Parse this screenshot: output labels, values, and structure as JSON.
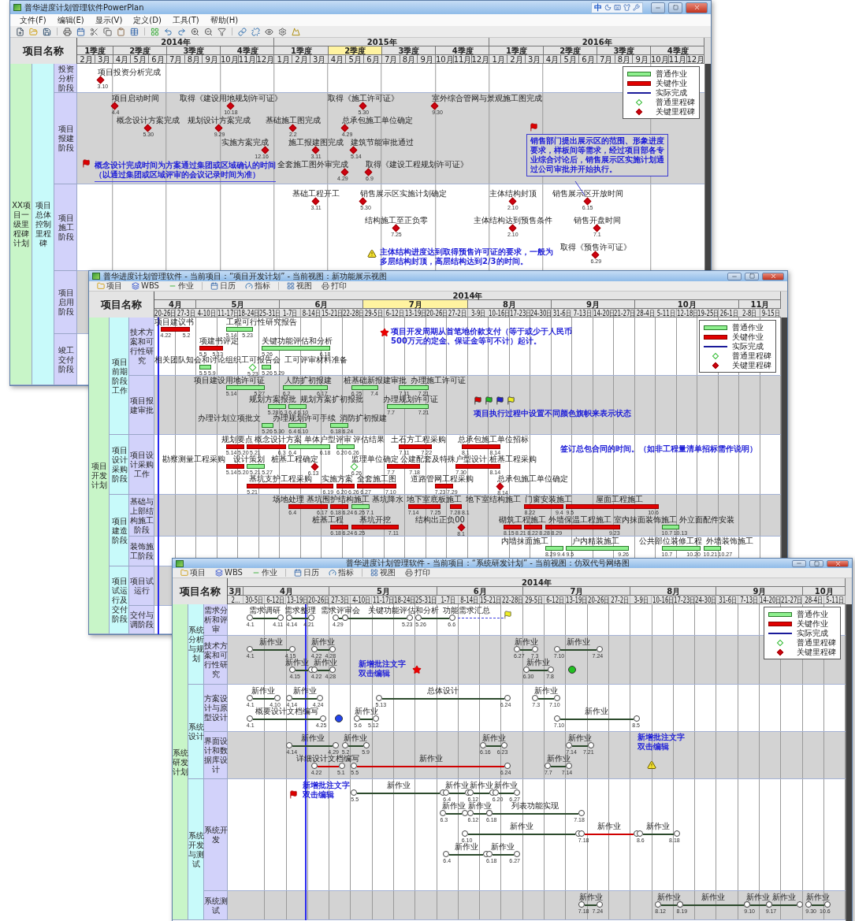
{
  "main_window": {
    "title": "普华进度计划管理软件PowerPlan",
    "ime_mode": "中",
    "menu": [
      "文件(F)",
      "编辑(E)",
      "显示(V)",
      "定义(D)",
      "工具(T)",
      "帮助(H)"
    ],
    "name_header": "项目名称",
    "timeline": {
      "years": [
        "2014年",
        "2015年",
        "2016年"
      ],
      "quarters": [
        {
          "label": "1季度",
          "selected": false
        },
        {
          "label": "2季度",
          "selected": false
        },
        {
          "label": "3季度",
          "selected": false
        },
        {
          "label": "4季度",
          "selected": false
        },
        {
          "label": "1季度",
          "selected": false
        },
        {
          "label": "2季度",
          "selected": true
        },
        {
          "label": "3季度",
          "selected": false
        },
        {
          "label": "4季度",
          "selected": false
        },
        {
          "label": "1季度",
          "selected": false
        },
        {
          "label": "2季度",
          "selected": false
        },
        {
          "label": "3季度",
          "selected": false
        },
        {
          "label": "4季度",
          "selected": false
        }
      ],
      "months": [
        "2月",
        "3月",
        "4月",
        "5月",
        "6月",
        "7月",
        "8月",
        "9月",
        "10月",
        "11月",
        "12月",
        "1月",
        "2月",
        "3月",
        "4月",
        "5月",
        "6月",
        "7月",
        "8月",
        "9月",
        "10月",
        "11月",
        "12月",
        "1月",
        "2月",
        "3月",
        "4月",
        "5月",
        "6月",
        "7月",
        "8月",
        "9月",
        "10月",
        "11月",
        "12月"
      ]
    },
    "legend": [
      {
        "kind": "normal_bar",
        "label": "普通作业"
      },
      {
        "kind": "critical_bar",
        "label": "关键作业"
      },
      {
        "kind": "actual_line",
        "label": "实际完成"
      },
      {
        "kind": "normal_milestone",
        "label": "普通里程碑"
      },
      {
        "kind": "critical_milestone",
        "label": "关键里程碑"
      }
    ],
    "tree": [
      {
        "label": "XX项目一级里程碑计划",
        "children": [
          {
            "label": "项目总体控制里程碑",
            "children": [
              {
                "label": "投资分析阶段",
                "items": [
                  {
                    "kind": "milestone",
                    "label": "项目投资分析完成",
                    "date": "3.10",
                    "critical": true
                  }
                ]
              },
              {
                "label": "项目报建阶段",
                "items": [
                  {
                    "kind": "milestone",
                    "label": "项目启动时间",
                    "date": "4.4",
                    "critical": true
                  },
                  {
                    "kind": "milestone",
                    "label": "取得《建设用地规划许可证》",
                    "date": "10.18",
                    "critical": true
                  },
                  {
                    "kind": "milestone",
                    "label": "取得《施工许可证》",
                    "date": "5.30",
                    "critical": true
                  },
                  {
                    "kind": "milestone",
                    "label": "室外综合管网与景观施工图完成",
                    "date": "9.30",
                    "critical": true
                  },
                  {
                    "kind": "milestone",
                    "label": "概念设计方案完成",
                    "date": "5.30",
                    "critical": true
                  },
                  {
                    "kind": "milestone",
                    "label": "规划设计方案完成",
                    "date": "9.29",
                    "critical": true
                  },
                  {
                    "kind": "milestone",
                    "label": "基础施工图完成",
                    "date": "2.2",
                    "critical": true
                  },
                  {
                    "kind": "milestone",
                    "label": "总承包施工单位确定",
                    "date": "4.29",
                    "critical": true
                  },
                  {
                    "kind": "milestone",
                    "label": "实施方案完成",
                    "date": "12.16",
                    "critical": true
                  },
                  {
                    "kind": "milestone",
                    "label": "施工报建图完成",
                    "date": "3.11",
                    "critical": true
                  },
                  {
                    "kind": "milestone",
                    "label": "建筑节能审批通过",
                    "date": "5.14",
                    "critical": true
                  },
                  {
                    "kind": "note",
                    "lines": [
                      "概念设计完成时间为方案通过集团或区域确认的时间",
                      "（以通过集团或区域评审的会议记录时间为准）"
                    ]
                  },
                  {
                    "kind": "milestone",
                    "label": "全套施工图外审完成",
                    "date": "4.29",
                    "critical": true
                  },
                  {
                    "kind": "milestone",
                    "label": "取得《建设工程规划许可证》",
                    "date": "6.9",
                    "critical": true
                  },
                  {
                    "kind": "note",
                    "lines": [
                      "销售部门提出展示区的范围、形象进度要求，样板间等需求，经过项目部各专业综合讨论后，销售展示区实施计划通过公司审批并开始执行。"
                    ]
                  }
                ]
              },
              {
                "label": "项目施工阶段",
                "items": [
                  {
                    "kind": "milestone",
                    "label": "基础工程开工",
                    "date": "3.11",
                    "critical": true
                  },
                  {
                    "kind": "milestone",
                    "label": "销售展示区实施计划确定",
                    "date": "5.30",
                    "critical": true
                  },
                  {
                    "kind": "milestone",
                    "label": "主体结构封顶",
                    "date": "2.10",
                    "critical": true
                  },
                  {
                    "kind": "milestone",
                    "label": "销售展示区开放时间",
                    "date": "6.15",
                    "critical": true
                  },
                  {
                    "kind": "milestone",
                    "label": "结构施工至正负零",
                    "date": "7.25",
                    "critical": true
                  },
                  {
                    "kind": "milestone",
                    "label": "主体结构达到预售条件",
                    "date": "2.10",
                    "critical": true
                  },
                  {
                    "kind": "milestone",
                    "label": "销售开盘时间",
                    "date": "7.1",
                    "critical": true
                  },
                  {
                    "kind": "note",
                    "lines": [
                      "主体结构进度达到取得预售许可证的要求，一般为",
                      "多层结构封顶，高层结构达到2/3的时间。"
                    ]
                  },
                  {
                    "kind": "milestone",
                    "label": "取得《预售许可证》",
                    "date": "6.29",
                    "critical": true
                  }
                ]
              },
              {
                "label": "项目启用阶段"
              },
              {
                "label": "竣工交付阶段"
              }
            ]
          }
        ]
      }
    ]
  },
  "project_window": {
    "title": "普华进度计划管理软件 - 当前项目：“项目开发计划” - 当前视图：新功能展示视图",
    "toolbar": [
      "项目",
      "WBS",
      "作业",
      "日历",
      "指标",
      "视图",
      "打印"
    ],
    "name_header": "项目名称",
    "timeline": {
      "years": [
        "2014年"
      ],
      "months": [
        {
          "label": "4月",
          "selected": false
        },
        {
          "label": "5月",
          "selected": false
        },
        {
          "label": "6月",
          "selected": false
        },
        {
          "label": "7月",
          "selected": true
        },
        {
          "label": "8月",
          "selected": false
        },
        {
          "label": "9月",
          "selected": false
        },
        {
          "label": "10月",
          "selected": false
        },
        {
          "label": "11月",
          "selected": false
        }
      ],
      "weeks": [
        "20-26日",
        "27-3日",
        "4-10日",
        "11-17日",
        "18-24日",
        "25-31日",
        "1-7日",
        "8-14日",
        "15-21日",
        "22-28日",
        "29-5日",
        "6-12日",
        "13-19日",
        "20-26日",
        "27-2日",
        "3-9日",
        "10-16日",
        "17-23日",
        "24-30日",
        "31-6日",
        "7-13日",
        "14-20日",
        "21-27日",
        "28-4日",
        "5-11日",
        "12-18日",
        "19-25日",
        "26-1日",
        "2-8日",
        "9-15日"
      ]
    },
    "legend": [
      {
        "kind": "normal_bar",
        "label": "普通作业"
      },
      {
        "kind": "critical_bar",
        "label": "关键作业"
      },
      {
        "kind": "actual_line",
        "label": "实际完成"
      },
      {
        "kind": "normal_milestone",
        "label": "普通里程碑"
      },
      {
        "kind": "critical_milestone",
        "label": "关键里程碑"
      }
    ],
    "tree": [
      {
        "label": "项目开发计划",
        "children": [
          {
            "label": "项目前期阶段工作",
            "children": [
              {
                "label": "技术方案和可行性研究",
                "items": [
                  {
                    "kind": "bar",
                    "label": "项目建议书",
                    "start": "4.22",
                    "end": "5.2",
                    "critical": true
                  },
                  {
                    "kind": "bar",
                    "label": "工程可行性研究报告",
                    "start": "5.14",
                    "end": "5.23",
                    "critical": false
                  },
                  {
                    "kind": "note",
                    "lines": [
                      "项目开发周期从首笔地价款支付（等于或少于人民币",
                      "500万元的定金、保证金等可不计）起计。"
                    ]
                  },
                  {
                    "kind": "bar",
                    "label": "项建书评定",
                    "start": "5.5",
                    "end": "5.13",
                    "critical": true
                  },
                  {
                    "kind": "bar",
                    "label": "关键功能评估和分析",
                    "start": "5.26",
                    "end": "6.18",
                    "critical": false
                  },
                  {
                    "kind": "bar",
                    "label": "相关团队知会和讨论",
                    "start": "5.5",
                    "end": "5.9",
                    "critical": false
                  },
                  {
                    "kind": "milestone",
                    "label": "组织工可报告会",
                    "date": "5.23",
                    "critical": false
                  },
                  {
                    "kind": "bar",
                    "label": "工可评审材料准备",
                    "start": "5.26",
                    "end": "5.29",
                    "critical": false
                  }
                ]
              },
              {
                "label": "项目报建审批",
                "items": [
                  {
                    "kind": "bar",
                    "label": "项目建设用地许可证",
                    "start": "5.14",
                    "end": "5.27",
                    "critical": false
                  },
                  {
                    "kind": "bar",
                    "label": "人防扩初报建",
                    "start": "6.2",
                    "end": "6.17",
                    "critical": false
                  },
                  {
                    "kind": "bar",
                    "label": "桩基础新报建审批",
                    "start": "6.25",
                    "end": "7.4",
                    "critical": false
                  },
                  {
                    "kind": "bar",
                    "label": "办理施工许可证",
                    "start": "7.11",
                    "end": "7.21",
                    "critical": false
                  },
                  {
                    "kind": "bar",
                    "label": "规划方案报批",
                    "start": "5.28",
                    "end": "6.3",
                    "critical": false
                  },
                  {
                    "kind": "bar",
                    "label": "规划方案扩初报批",
                    "start": "6.4",
                    "end": "6.10",
                    "critical": false
                  },
                  {
                    "kind": "bar",
                    "label": "办理规划许可证",
                    "start": "7.7",
                    "end": "7.21",
                    "critical": false
                  },
                  {
                    "kind": "note",
                    "lines": [
                      "项目执行过程中设置不同颜色旗帜来表示状态"
                    ]
                  },
                  {
                    "kind": "bar",
                    "label": "办理计划立项批文",
                    "start": "5.26",
                    "end": "5.30",
                    "critical": false
                  },
                  {
                    "kind": "bar",
                    "label": "办理规划许可手续",
                    "start": "6.4",
                    "end": "6.10",
                    "critical": false
                  },
                  {
                    "kind": "bar",
                    "label": "消防扩初报建",
                    "start": "6.18",
                    "end": "6.24",
                    "critical": false
                  }
                ]
              }
            ]
          },
          {
            "label": "项目设计采购阶段",
            "children": [
              {
                "label": "项目设计采购工作",
                "items": [
                  {
                    "kind": "bar",
                    "label": "规划要点",
                    "start": "5.14",
                    "end": "5.20",
                    "critical": true
                  },
                  {
                    "kind": "bar",
                    "label": "概念设计方案",
                    "start": "5.21",
                    "end": "6.3",
                    "critical": true
                  },
                  {
                    "kind": "bar",
                    "label": "单体户型评审",
                    "start": "6.4",
                    "end": "6.18",
                    "critical": false
                  },
                  {
                    "kind": "bar",
                    "label": "评估结果",
                    "start": "6.20",
                    "end": "6.26",
                    "critical": false
                  },
                  {
                    "kind": "bar",
                    "label": "土石方工程采购",
                    "start": "7.11",
                    "end": "7.22",
                    "critical": true
                  },
                  {
                    "kind": "bar",
                    "label": "总承包施工单位招标",
                    "start": "8.1",
                    "end": "8.14",
                    "critical": true
                  },
                  {
                    "kind": "note",
                    "lines": [
                      "签订总包合同的时间。（如非工程量清单招标需作说明）"
                    ]
                  },
                  {
                    "kind": "bar",
                    "label": "勘察测量工程采购",
                    "start": "5.14",
                    "end": "5.20",
                    "critical": true
                  },
                  {
                    "kind": "bar",
                    "label": "设计策划",
                    "start": "5.21",
                    "end": "5.27",
                    "critical": false
                  },
                  {
                    "kind": "milestone",
                    "label": "桩基工程确定",
                    "date": "6.13",
                    "critical": true
                  },
                  {
                    "kind": "milestone",
                    "label": "监理单位确定",
                    "date": "6.26",
                    "critical": false
                  },
                  {
                    "kind": "bar",
                    "label": "公建配套及特殊户型设计",
                    "start": "7.7",
                    "end": "7.18",
                    "critical": true
                  },
                  {
                    "kind": "bar",
                    "label": "桩基工程采购",
                    "start": "7.30",
                    "end": "8.14",
                    "critical": true
                  },
                  {
                    "kind": "bar",
                    "label": "基坑支护工程采购",
                    "start": "5.21",
                    "end": "6.19",
                    "critical": true
                  },
                  {
                    "kind": "bar",
                    "label": "实施方案",
                    "start": "6.20",
                    "end": "6.26",
                    "critical": true
                  },
                  {
                    "kind": "bar",
                    "label": "全套施工图",
                    "start": "6.27",
                    "end": "7.10",
                    "critical": true
                  },
                  {
                    "kind": "bar",
                    "label": "道路管网工程采购",
                    "start": "7.23",
                    "end": "7.29",
                    "critical": true
                  },
                  {
                    "kind": "milestone",
                    "label": "总承包施工单位确定",
                    "date": "8.14",
                    "critical": true
                  }
                ]
              }
            ]
          },
          {
            "label": "项目建造阶段",
            "children": [
              {
                "label": "基础与上部结构施工阶段",
                "items": [
                  {
                    "kind": "bar",
                    "label": "场地处理",
                    "start": "6.4",
                    "end": "6.17",
                    "critical": true
                  },
                  {
                    "kind": "bar",
                    "label": "基坑围护结构施工",
                    "start": "6.18",
                    "end": "6.24",
                    "critical": true
                  },
                  {
                    "kind": "bar",
                    "label": "基坑降水",
                    "start": "6.25",
                    "end": "7.1",
                    "critical": false
                  },
                  {
                    "kind": "bar",
                    "label": "地下室底板施工",
                    "start": "7.14",
                    "end": "7.25",
                    "critical": true
                  },
                  {
                    "kind": "bar",
                    "label": "地下室结构施工",
                    "start": "7.28",
                    "end": "8.1",
                    "critical": true
                  },
                  {
                    "kind": "bar",
                    "label": "门窗安装施工",
                    "start": "8.22",
                    "end": "9.4",
                    "critical": true
                  },
                  {
                    "kind": "bar",
                    "label": "屋面工程施工",
                    "start": "9.5",
                    "end": "10.6",
                    "critical": true
                  },
                  {
                    "kind": "bar",
                    "label": "桩基工程",
                    "start": "6.18",
                    "end": "6.24",
                    "critical": true
                  },
                  {
                    "kind": "bar",
                    "label": "基坑开挖",
                    "start": "6.25",
                    "end": "7.11",
                    "critical": true
                  },
                  {
                    "kind": "milestone",
                    "label": "结构出正负00",
                    "date": "8.1",
                    "critical": true
                  },
                  {
                    "kind": "bar",
                    "label": "砌筑工程施工",
                    "start": "8.15",
                    "end": "8.21",
                    "critical": true
                  },
                  {
                    "kind": "bar",
                    "label": "外墙保温工程施工",
                    "start": "8.22",
                    "end": "8.28",
                    "critical": true
                  },
                  {
                    "kind": "bar",
                    "label": "室内抹面装饰施工",
                    "start": "8.29",
                    "end": "9.23",
                    "critical": true
                  },
                  {
                    "kind": "bar",
                    "label": "外立面配件安装",
                    "start": "10.7",
                    "end": "10.13",
                    "critical": false
                  }
                ]
              },
              {
                "label": "装饰施工阶段",
                "items": [
                  {
                    "kind": "bar",
                    "label": "内墙抹面施工",
                    "start": "8.29",
                    "end": "9.4",
                    "critical": false
                  },
                  {
                    "kind": "bar",
                    "label": "户内精装施工",
                    "start": "9.5",
                    "end": "9.26",
                    "critical": false
                  },
                  {
                    "kind": "bar",
                    "label": "公共部位装修工程",
                    "start": "10.7",
                    "end": "10.20",
                    "critical": false
                  },
                  {
                    "kind": "bar",
                    "label": "外墙装饰施工",
                    "start": "10.21",
                    "end": "10.27",
                    "critical": false
                  }
                ]
              }
            ]
          },
          {
            "label": "项目试运行及交付阶段",
            "children": [
              {
                "label": "项目试运行"
              },
              {
                "label": "交付与调阶段"
              }
            ]
          }
        ]
      }
    ]
  },
  "network_window": {
    "title": "普华进度计划管理软件 - 当前项目：“系统研发计划” - 当前视图：仿双代号网络图",
    "toolbar": [
      "项目",
      "WBS",
      "作业",
      "日历",
      "指标",
      "视图",
      "打印"
    ],
    "name_header": "项目名称",
    "timeline": {
      "years": [
        "2014年"
      ],
      "months": [
        {
          "label": "3月",
          "selected": false
        },
        {
          "label": "4月",
          "selected": false
        },
        {
          "label": "5月",
          "selected": false
        },
        {
          "label": "6月",
          "selected": false
        },
        {
          "label": "7月",
          "selected": false
        },
        {
          "label": "8月",
          "selected": false
        },
        {
          "label": "9月",
          "selected": false
        },
        {
          "label": "10月",
          "selected": false
        }
      ],
      "weeks": [
        "2...",
        "30-5日",
        "6-12日",
        "13-19日",
        "20-26日",
        "27-3日",
        "4-10日",
        "11-17日",
        "18-24日",
        "25-31日",
        "1-7日",
        "8-14日",
        "15-21日",
        "22-28日",
        "29-5日",
        "6-12日",
        "13-19日",
        "20-26日",
        "27-2日",
        "3-9日",
        "10-16日",
        "17-23日",
        "24-30日",
        "31-6日",
        "7-13日",
        "14-20日",
        "21-27日",
        "28-4日",
        "5-11日"
      ]
    },
    "legend": [
      {
        "kind": "normal_bar",
        "label": "普通作业"
      },
      {
        "kind": "critical_bar",
        "label": "关键作业"
      },
      {
        "kind": "actual_line",
        "label": "实际完成"
      },
      {
        "kind": "normal_milestone",
        "label": "普通里程碑"
      },
      {
        "kind": "critical_milestone",
        "label": "关键里程碑"
      }
    ],
    "tree": [
      {
        "label": "系统研发计划",
        "children": [
          {
            "label": "系统分析与规划",
            "children": [
              {
                "label": "需求分析和评审",
                "items": [
                  {
                    "kind": "activity",
                    "label": "需求调研",
                    "start": "4.1",
                    "end": "4.11",
                    "critical": false
                  },
                  {
                    "kind": "activity",
                    "label": "需求整理",
                    "start": "4.14",
                    "end": "4.21",
                    "critical": false
                  },
                  {
                    "kind": "activity",
                    "label": "需求评审会",
                    "start": "4.29",
                    "critical": false
                  },
                  {
                    "kind": "activity",
                    "label": "关键功能评估和分析",
                    "end": "5.23",
                    "critical": false
                  },
                  {
                    "kind": "activity",
                    "label": "功能需求汇总",
                    "start": "5.26",
                    "end": "6.6",
                    "critical": false
                  }
                ]
              },
              {
                "label": "技术方案和可行性研究",
                "items": [
                  {
                    "kind": "activity",
                    "label": "新作业",
                    "start": "4.1",
                    "end": "4.15",
                    "critical": false
                  },
                  {
                    "kind": "activity",
                    "label": "新作业",
                    "start": "4.22",
                    "end": "4.28",
                    "critical": false
                  },
                  {
                    "kind": "activity",
                    "label": "新作业",
                    "start": "6.27",
                    "end": "7.3",
                    "critical": false
                  },
                  {
                    "kind": "activity",
                    "label": "新作业",
                    "start": "7.10",
                    "end": "7.24",
                    "critical": false
                  },
                  {
                    "kind": "activity",
                    "label": "新作业",
                    "start": "4.15",
                    "critical": false
                  },
                  {
                    "kind": "activity",
                    "label": "新作业",
                    "start": "4.22",
                    "end": "4.28",
                    "critical": false
                  },
                  {
                    "kind": "note",
                    "lines": [
                      "新增批注文字",
                      "双击编辑"
                    ]
                  },
                  {
                    "kind": "activity",
                    "label": "新作业",
                    "start": "6.30",
                    "end": "7.8",
                    "critical": false
                  }
                ]
              }
            ]
          },
          {
            "label": "系统设计",
            "children": [
              {
                "label": "方案设计与原型设计",
                "items": [
                  {
                    "kind": "activity",
                    "label": "新作业",
                    "start": "4.1",
                    "end": "4.10",
                    "critical": false
                  },
                  {
                    "kind": "activity",
                    "label": "新作业",
                    "start": "4.14",
                    "end": "4.24",
                    "critical": false
                  },
                  {
                    "kind": "activity",
                    "label": "总体设计",
                    "start": "5.13",
                    "end": "6.24",
                    "critical": false
                  },
                  {
                    "kind": "activity",
                    "label": "新作业",
                    "start": "7.3",
                    "end": "7.10",
                    "critical": false
                  },
                  {
                    "kind": "activity",
                    "label": "概要设计文档编写",
                    "start": "4.1",
                    "end": "4.25",
                    "critical": false
                  },
                  {
                    "kind": "activity",
                    "label": "新作业",
                    "start": "5.6",
                    "end": "5.12",
                    "critical": false
                  },
                  {
                    "kind": "activity",
                    "label": "新作业",
                    "start": "7.10",
                    "end": "8.5",
                    "critical": false
                  }
                ]
              },
              {
                "label": "界面设计和数据库设计",
                "items": [
                  {
                    "kind": "activity",
                    "label": "新作业",
                    "start": "4.14",
                    "end": "4.29",
                    "critical": false
                  },
                  {
                    "kind": "activity",
                    "label": "新作业",
                    "start": "5.2",
                    "end": "5.9",
                    "critical": false
                  },
                  {
                    "kind": "activity",
                    "label": "新作业",
                    "start": "6.16",
                    "end": "6.23",
                    "critical": false
                  },
                  {
                    "kind": "activity",
                    "label": "新作业",
                    "start": "7.14",
                    "end": "7.21",
                    "critical": false
                  },
                  {
                    "kind": "note",
                    "lines": [
                      "新增批注文字",
                      "双击编辑"
                    ]
                  },
                  {
                    "kind": "activity",
                    "label": "详细设计文档编写",
                    "start": "4.22",
                    "end": "5.1",
                    "critical": true
                  },
                  {
                    "kind": "activity",
                    "label": "新作业",
                    "start": "5.5",
                    "end": "6.24",
                    "critical": true
                  },
                  {
                    "kind": "activity",
                    "label": "新作业",
                    "start": "7.7",
                    "end": "7.14",
                    "critical": false
                  }
                ]
              }
            ]
          },
          {
            "label": "系统开发与测试",
            "children": [
              {
                "label": "系统开发",
                "items": [
                  {
                    "kind": "note",
                    "lines": [
                      "新增批注文字",
                      "双击编辑"
                    ]
                  },
                  {
                    "kind": "activity",
                    "label": "新作业",
                    "start": "5.5",
                    "critical": false
                  },
                  {
                    "kind": "activity",
                    "label": "新作业",
                    "start": "6.4",
                    "critical": false
                  },
                  {
                    "kind": "activity",
                    "label": "新作业",
                    "start": "6.12",
                    "critical": false
                  },
                  {
                    "kind": "activity",
                    "label": "新作业",
                    "start": "6.20",
                    "end": "6.27",
                    "critical": false
                  },
                  {
                    "kind": "activity",
                    "label": "新作业",
                    "start": "6.3",
                    "critical": false
                  },
                  {
                    "kind": "activity",
                    "label": "新作业",
                    "start": "6.12",
                    "critical": false
                  },
                  {
                    "kind": "activity",
                    "label": "列表功能实现",
                    "start": "6.18",
                    "end": "7.18",
                    "critical": false
                  },
                  {
                    "kind": "activity",
                    "label": "新作业",
                    "start": "6.10",
                    "critical": false
                  },
                  {
                    "kind": "activity",
                    "label": "新作业",
                    "start": "7.18",
                    "critical": true
                  },
                  {
                    "kind": "activity",
                    "label": "新作业",
                    "start": "8.6",
                    "end": "8.18",
                    "critical": false
                  },
                  {
                    "kind": "activity",
                    "label": "新作业",
                    "start": "6.4",
                    "critical": false
                  },
                  {
                    "kind": "activity",
                    "label": "新作业",
                    "start": "6.18",
                    "end": "6.27",
                    "critical": false
                  }
                ]
              },
              {
                "label": "系统测试",
                "items": [
                  {
                    "kind": "activity",
                    "label": "新作业",
                    "start": "7.18",
                    "end": "7.24",
                    "critical": false
                  },
                  {
                    "kind": "activity",
                    "label": "新作业",
                    "start": "8.12",
                    "critical": false
                  },
                  {
                    "kind": "activity",
                    "label": "新作业",
                    "start": "8.19",
                    "critical": false
                  },
                  {
                    "kind": "activity",
                    "label": "新作业",
                    "start": "9.10",
                    "critical": false
                  },
                  {
                    "kind": "activity",
                    "label": "新作业",
                    "start": "9.17",
                    "critical": false
                  },
                  {
                    "kind": "activity",
                    "label": "新作业",
                    "start": "9.30",
                    "end": "10.6",
                    "critical": false
                  }
                ]
              }
            ]
          }
        ]
      }
    ]
  }
}
